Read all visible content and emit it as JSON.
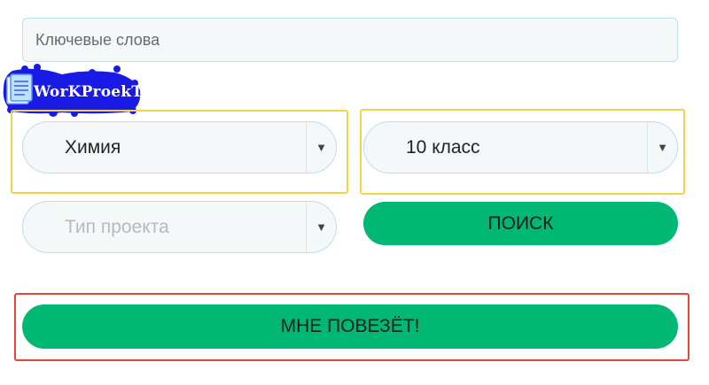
{
  "search": {
    "keywords_placeholder": "Ключевые слова"
  },
  "logo": {
    "text": "WorKProekT"
  },
  "filters": {
    "subject": {
      "value": "Химия"
    },
    "grade": {
      "value": "10 класс"
    },
    "project_type": {
      "placeholder": "Тип проекта"
    }
  },
  "buttons": {
    "search_label": "ПОИСК",
    "lucky_label": "МНЕ ПОВЕЗЁТ!"
  },
  "colors": {
    "accent_green": "#00b874",
    "highlight_yellow": "#f4d346",
    "highlight_red": "#e8443a",
    "logo_blue": "#1a1ae6"
  }
}
